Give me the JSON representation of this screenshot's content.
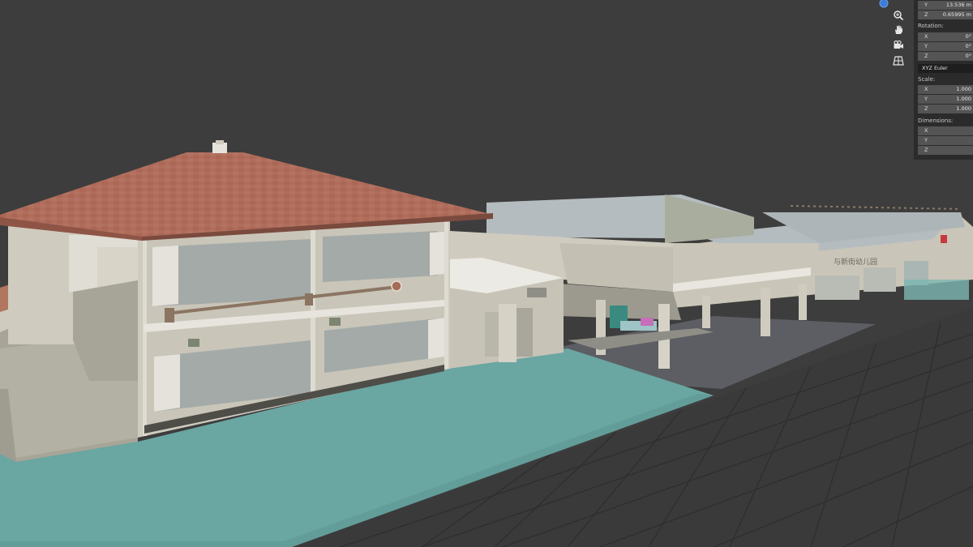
{
  "app": {
    "name": "Blender",
    "view": "3D Viewport",
    "colors": {
      "background": "#3d3d3d",
      "grid": "#2f2f2f",
      "panel": "#2b2b2b",
      "field": "#545454"
    }
  },
  "navigation": {
    "buttons": [
      {
        "icon": "zoom-icon"
      },
      {
        "icon": "pan-hand-icon"
      },
      {
        "icon": "camera-icon"
      },
      {
        "icon": "perspective-grid-icon"
      }
    ],
    "overlay_dot_color": "#3c7ddb"
  },
  "n_panel": {
    "location": [
      {
        "axis": "Y",
        "value": "13.536 m"
      },
      {
        "axis": "Z",
        "value": "0.65995 m"
      }
    ],
    "rotation_label": "Rotation:",
    "rotation": [
      {
        "axis": "X",
        "value": "0°"
      },
      {
        "axis": "Y",
        "value": "0°"
      },
      {
        "axis": "Z",
        "value": "0°"
      }
    ],
    "rotation_mode": "XYZ Euler",
    "scale_label": "Scale:",
    "scale": [
      {
        "axis": "X",
        "value": "1.000"
      },
      {
        "axis": "Y",
        "value": "1.000"
      },
      {
        "axis": "Z",
        "value": "1.000"
      }
    ],
    "dimensions_label": "Dimensions:",
    "dimensions": [
      {
        "axis": "X",
        "value": ""
      },
      {
        "axis": "Y",
        "value": ""
      },
      {
        "axis": "Z",
        "value": ""
      }
    ]
  },
  "scene": {
    "sign_text": "与新街幼儿园",
    "colors": {
      "roof_tile": "#b06d5c",
      "roof_tile_dark": "#8e5546",
      "wall": "#cfcbbf",
      "wall_shadow": "#a7a597",
      "window_panel": "#a3aaa8",
      "flat_roof": "#b5bcc0",
      "ground_teal": "#6aa6a2",
      "ground_dark": "#5c5e63"
    }
  }
}
